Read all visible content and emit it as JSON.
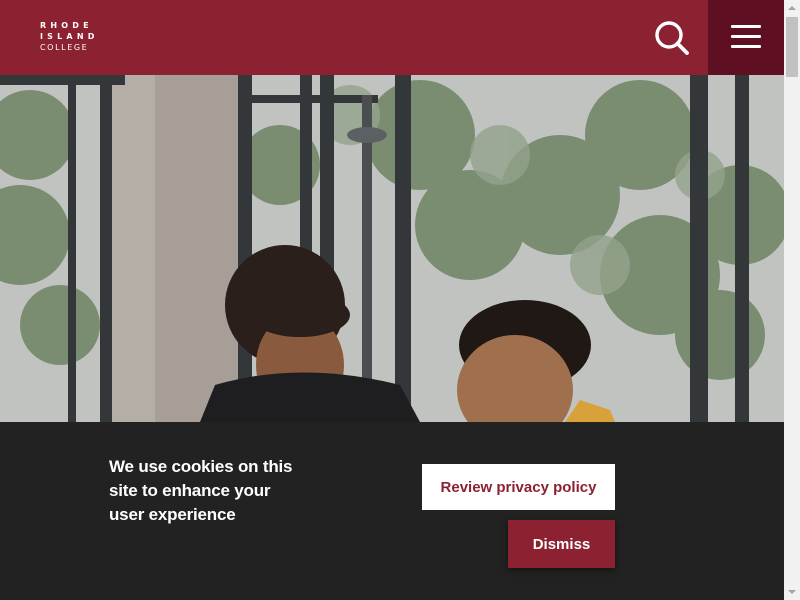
{
  "header": {
    "logo": {
      "line1": "RHODE",
      "line2": "ISLAND",
      "line3": "COLLEGE"
    },
    "search_icon": "search-icon",
    "menu_icon": "hamburger-menu-icon"
  },
  "hero": {
    "image": "photo of two students in front of large windows with trees outside"
  },
  "cookie_banner": {
    "message": "We use cookies on this site to enhance your user experience",
    "review_label": "Review privacy policy",
    "dismiss_label": "Dismiss"
  },
  "colors": {
    "brand": "#8b2131",
    "brand_dark": "#5e0f22",
    "banner_bg": "#222222"
  }
}
